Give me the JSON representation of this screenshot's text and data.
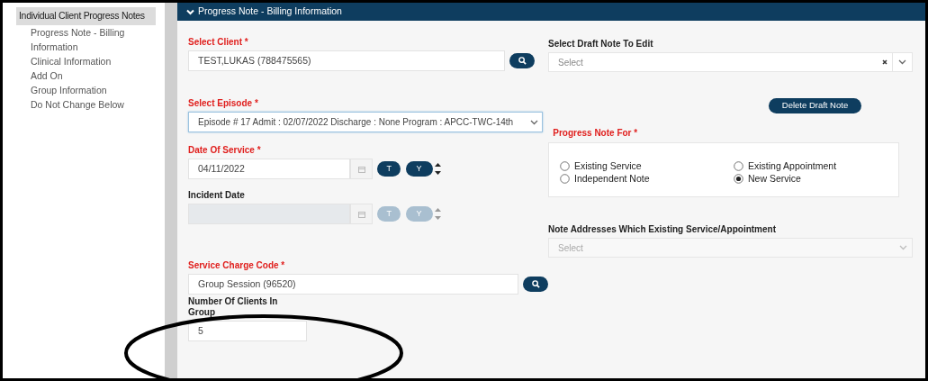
{
  "sidebar": {
    "items": [
      {
        "label": "Individual Client Progress Notes",
        "selected": true,
        "children": [
          {
            "label": "Progress Note - Billing Information",
            "selected": false
          },
          {
            "label": "Clinical Information",
            "selected": false
          },
          {
            "label": "Add On",
            "selected": false
          },
          {
            "label": "Group Information",
            "selected": false
          },
          {
            "label": "Do Not Change Below",
            "selected": false
          }
        ]
      }
    ]
  },
  "section": {
    "title": "Progress Note - Billing Information",
    "expanded": true
  },
  "left_fields": [
    {
      "kind": "lookup",
      "label": "Select Client",
      "required_mark": "*",
      "value": "TEST,LUKAS (788475565)"
    },
    {
      "kind": "select",
      "label": "Select Episode",
      "required_mark": "*",
      "value": "Episode # 17 Admit : 02/07/2022 Discharge : None Program : APCC-TWC-14th",
      "focused": true
    },
    {
      "kind": "date",
      "label": "Date Of Service",
      "required_mark": "*",
      "value": "04/11/2022",
      "disabled": false,
      "today_button": "T",
      "yesterday_button": "Y"
    },
    {
      "kind": "date",
      "label": "Incident Date",
      "disabled": true,
      "today_button": "T",
      "yesterday_button": "Y"
    },
    {
      "kind": "lookup",
      "label": "Service Charge Code",
      "required_mark": "*",
      "value": "Group Session (96520)"
    },
    {
      "kind": "text",
      "label": "Number Of Clients In Group",
      "value": "5"
    }
  ],
  "draft_select": {
    "label": "Select Draft Note To Edit",
    "placeholder": "Select",
    "clearable": true
  },
  "delete_button": "Delete Draft Note",
  "progress_note_for": {
    "label": "Progress Note For",
    "required_mark": "*",
    "options": [
      {
        "label": "Existing Service",
        "selected": false
      },
      {
        "label": "Existing Appointment",
        "selected": false
      },
      {
        "label": "Independent Note",
        "selected": false
      },
      {
        "label": "New Service",
        "selected": true
      }
    ]
  },
  "addresses_select": {
    "label": "Note Addresses Which Existing Service/Appointment",
    "placeholder": "Select",
    "disabled": true
  },
  "annotation": {
    "kind": "ellipse"
  }
}
